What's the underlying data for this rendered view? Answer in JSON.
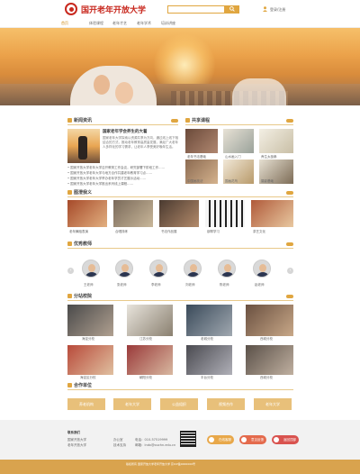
{
  "header": {
    "logo_text": "国开老年开放大学",
    "search_placeholder": "",
    "search_icon": "search-icon",
    "login_text": "登录/注册"
  },
  "nav": {
    "items": [
      "首页",
      "体验课程",
      "老年才艺",
      "老年学术",
      "培训讲座"
    ],
    "active_index": 0
  },
  "sections": {
    "news": {
      "title": "新闻资讯",
      "headline": "国家老年学会养生的大着",
      "body": "国家老年大学探索以资源共享为方向，通过线上线下相结合的方式，推动老年教育高质量发展，满足广大老年人多样化的学习需求，让老年人享受美好晚年生活。",
      "list": [
        "• 国家开放大学老年大学召开教育工作会议，研究部署下阶段工作……",
        "• 国家开放大学老年大学与地方合作共建老年教育学习点……",
        "• 国家开放大学老年大学举办老年学员才艺展示活动……",
        "• 国家开放大学老年大学推出系列线上课程……"
      ]
    },
    "courses": {
      "title": "共享课程",
      "items": [
        "老年书法基础",
        "山水画入门",
        "养生太极拳",
        "中国画技法",
        "国画花鸟",
        "摄影基础"
      ]
    },
    "show": {
      "title": "图澄我义",
      "items": [
        "老年舞蹈表演",
        "合唱排练",
        "书法作品展",
        "钢琴学习",
        "茶艺文化"
      ]
    },
    "teachers": {
      "title": "优秀教师",
      "names": [
        "王老师",
        "张老师",
        "李老师",
        "刘老师",
        "陈老师",
        "赵老师",
        "周老师"
      ]
    },
    "branches": {
      "title": "分站校院",
      "items": [
        "海淀分校",
        "江苏分校",
        "老城分校",
        "西城分校",
        "海淀区分校",
        "朝阳分校",
        "丰台分校",
        "西城分校"
      ]
    },
    "partners": {
      "title": "合作单位",
      "items": [
        "养老机构",
        "老年大学",
        "公益组织",
        "视频合作",
        "老年大学"
      ]
    }
  },
  "footer": {
    "col1_title": "联系我们",
    "col1_lines": [
      "国家开放大学",
      "老年开放大学"
    ],
    "col2_lines": [
      "办公室",
      "技术支持"
    ],
    "col3_lines": [
      "电话：010-57519999",
      "邮箱：lndx@ouchn.edu.cn"
    ],
    "pills": [
      "在线客服",
      "意见反馈",
      "返回顶部"
    ],
    "pill_colors": [
      "#e8a84a",
      "#e46b4d",
      "#d9534f"
    ],
    "copyright": "版权所有 国家开放大学老年开放大学 京ICP备0000000号"
  },
  "colors": {
    "accent": "#e0a640",
    "brand": "#c8281e"
  }
}
